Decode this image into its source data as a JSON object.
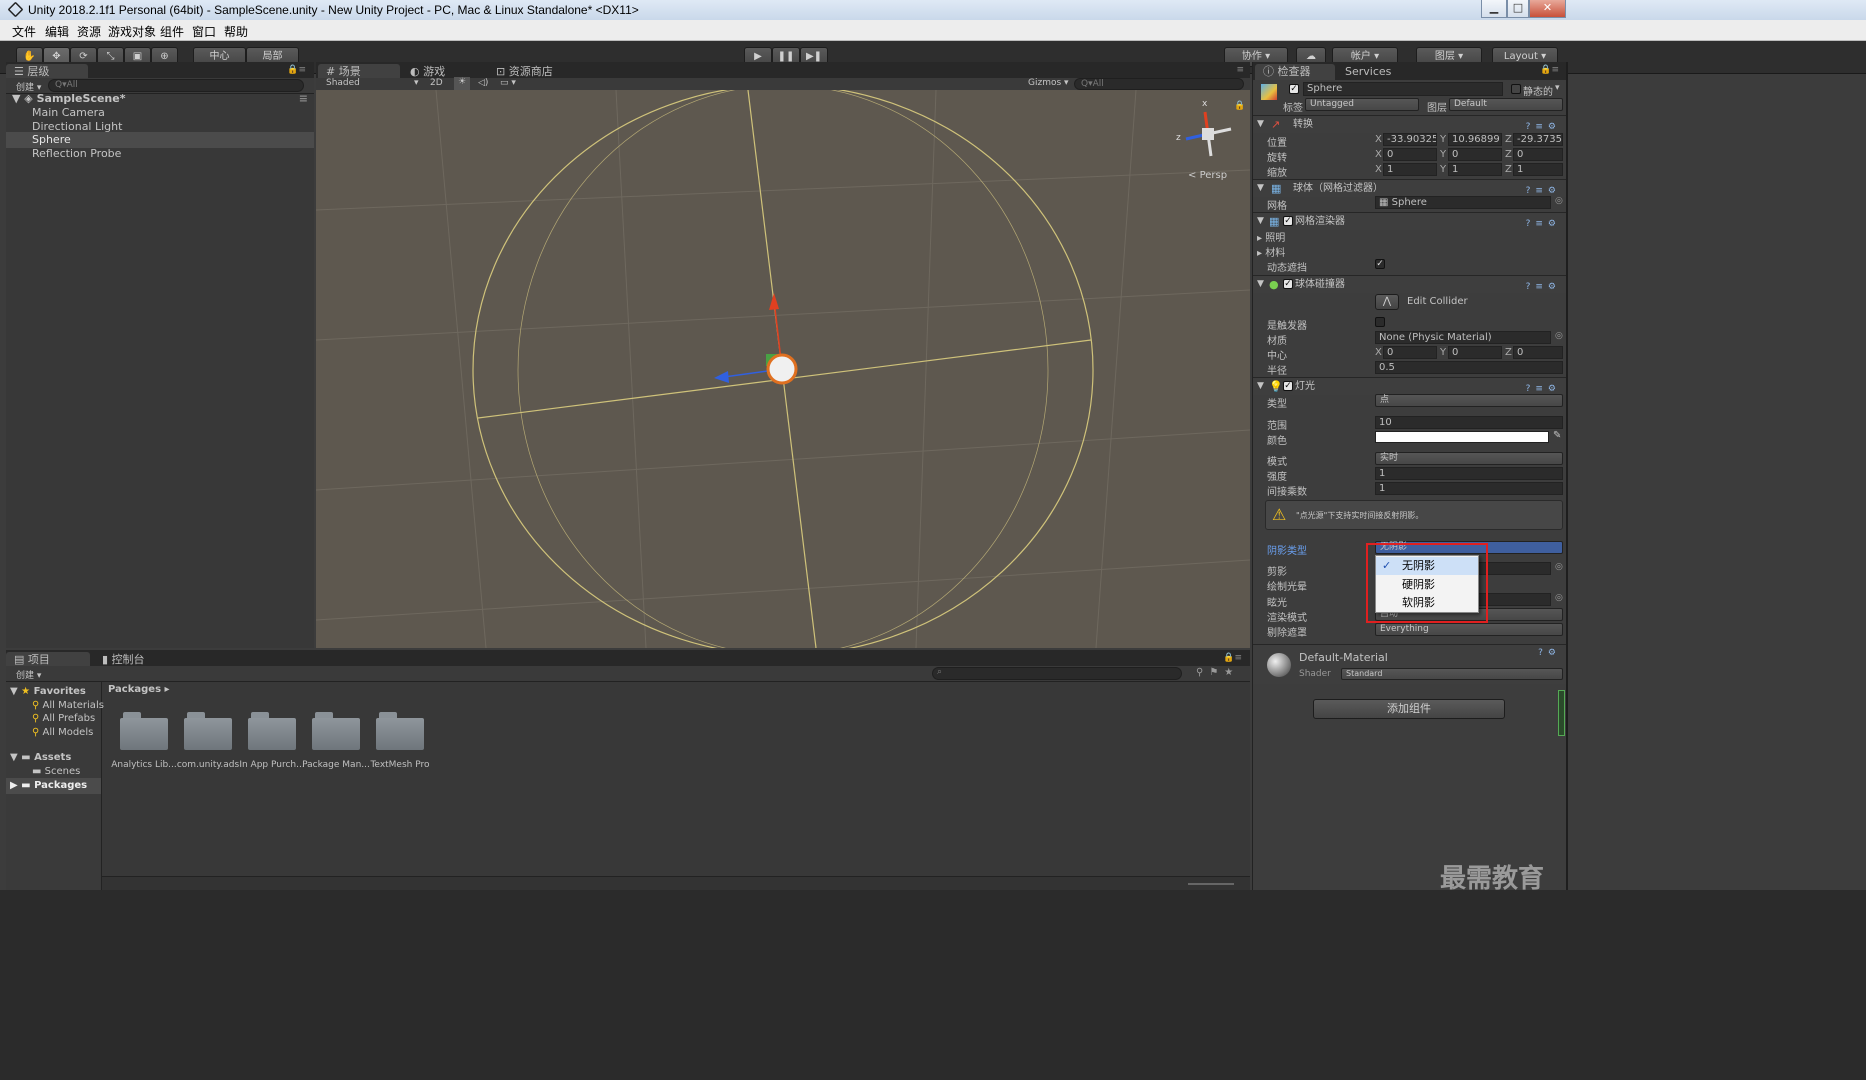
{
  "window": {
    "title": "Unity 2018.2.1f1 Personal (64bit) - SampleScene.unity - New Unity Project - PC, Mac & Linux Standalone* <DX11>",
    "min": "▁",
    "max": "□",
    "close": "✕"
  },
  "menu": [
    "文件",
    "编辑",
    "资源",
    "游戏对象",
    "组件",
    "窗口",
    "帮助"
  ],
  "toolbar": {
    "pivot": "中心",
    "local": "局部",
    "play": "▶",
    "pause": "❚❚",
    "step": "▶❚",
    "collab": "协作",
    "account": "帐户",
    "layers": "图层",
    "layout": "Layout"
  },
  "hierarchy": {
    "tab": "层级",
    "create": "创建",
    "search_placeholder": "Q▾All",
    "scene": "SampleScene*",
    "items": [
      "Main Camera",
      "Directional Light",
      "Sphere",
      "Reflection Probe"
    ]
  },
  "scene": {
    "tabs": [
      "场景",
      "游戏",
      "资源商店"
    ],
    "shading": "Shaded",
    "mode2d": "2D",
    "gizmos": "Gizmos",
    "search_placeholder": "Q▾All",
    "persp": "Persp",
    "gizmo_axes": [
      "x",
      "z"
    ]
  },
  "project": {
    "tabs": [
      "项目",
      "控制台"
    ],
    "create": "创建",
    "favorites": "Favorites",
    "fav_items": [
      "All Materials",
      "All Prefabs",
      "All Models"
    ],
    "assets": "Assets",
    "asset_items": [
      "Scenes"
    ],
    "packages": "Packages",
    "breadcrumb": "Packages",
    "folders": [
      "Analytics Lib...",
      "com.unity.ads",
      "In App Purch...",
      "Package Man...",
      "TextMesh Pro"
    ]
  },
  "inspector": {
    "tabs": [
      "检查器",
      "Services"
    ],
    "object_name": "Sphere",
    "static": "静态的",
    "tag_label": "标签",
    "tag_value": "Untagged",
    "layer_label": "图层",
    "layer_value": "Default",
    "transform": {
      "title": "转换",
      "position_label": "位置",
      "position": [
        "-33.90325",
        "10.96899",
        "-29.3735"
      ],
      "rotation_label": "旋转",
      "rotation": [
        "0",
        "0",
        "0"
      ],
      "scale_label": "缩放",
      "scale": [
        "1",
        "1",
        "1"
      ],
      "axes": [
        "X",
        "Y",
        "Z"
      ]
    },
    "mesh_filter": {
      "title": "球体（网格过滤器）",
      "mesh_label": "网格",
      "mesh_value": "Sphere"
    },
    "mesh_renderer": {
      "title": "网格渲染器",
      "lighting": "照明",
      "materials": "材料",
      "dynamic_occluded": "动态遮挡"
    },
    "sphere_collider": {
      "title": "球体碰撞器",
      "edit": "Edit Collider",
      "is_trigger": "是触发器",
      "material_label": "材质",
      "material_value": "None (Physic Material)",
      "center_label": "中心",
      "center": [
        "0",
        "0",
        "0"
      ],
      "radius_label": "半径",
      "radius": "0.5"
    },
    "light": {
      "title": "灯光",
      "type_label": "类型",
      "type_value": "点",
      "range_label": "范围",
      "range": "10",
      "color_label": "颜色",
      "mode_label": "模式",
      "mode_value": "实时",
      "intensity_label": "强度",
      "intensity": "1",
      "indirect_label": "间接乘数",
      "indirect": "1",
      "warning": "\"点光源\"下支持实时间接反射阴影。",
      "shadow_type_label": "阴影类型",
      "shadow_type_value": "无阴影",
      "cookie_label": "剪影",
      "draw_halo_label": "绘制光晕",
      "flare_label": "眩光",
      "render_mode_label": "渲染模式",
      "render_mode_value": "自动",
      "culling_label": "剔除遮罩",
      "culling_value": "Everything"
    },
    "material": {
      "name": "Default-Material",
      "shader_label": "Shader",
      "shader_value": "Standard"
    },
    "add_component": "添加组件",
    "popup": {
      "options": [
        "无阴影",
        "硬阴影",
        "软阴影"
      ],
      "selected": 0,
      "check": "✓"
    }
  },
  "watermark": "最需教育"
}
